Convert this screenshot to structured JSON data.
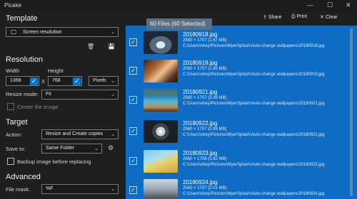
{
  "app": {
    "title": "Picake"
  },
  "toolbar": {
    "share": "Share",
    "print": "Print",
    "clear": "Clear"
  },
  "template": {
    "heading": "Template",
    "selected": "Screen resolution"
  },
  "resolution": {
    "heading": "Resolution",
    "width_label": "Width",
    "height_label": "Height",
    "width": "1366",
    "height": "768",
    "x": "X",
    "unit": "Pixels",
    "resize_mode_label": "Resize mode:",
    "resize_mode": "Fit",
    "center_label": "Center the image"
  },
  "target": {
    "heading": "Target",
    "action_label": "Action:",
    "action": "Resize and Create copies",
    "save_to_label": "Save to:",
    "save_to": "Same Folder",
    "backup_label": "Backup image before replacing"
  },
  "advanced": {
    "heading": "Advanced",
    "file_mask_label": "File mask:",
    "file_mask": "%F"
  },
  "files": {
    "count_label": "60 Files (60 Selected)",
    "items": [
      {
        "name": "20180918.jpg",
        "meta": "2560 × 1707 (1.67 MB)",
        "path": "C:\\Users\\shey\\Pictures\\MyerSplash\\Auto-change wallpapers\\20180918.jpg"
      },
      {
        "name": "20180919.jpg",
        "meta": "2560 × 1707 (1.85 MB)",
        "path": "C:\\Users\\shey\\Pictures\\MyerSplash\\Auto-change wallpapers\\20180919.jpg"
      },
      {
        "name": "20180921.jpg",
        "meta": "2560 × 1707 (3.38 MB)",
        "path": "C:\\Users\\shey\\Pictures\\MyerSplash\\Auto-change wallpapers\\20180921.jpg"
      },
      {
        "name": "20180922.jpg",
        "meta": "2560 × 1707 (0.99 MB)",
        "path": "C:\\Users\\shey\\Pictures\\MyerSplash\\Auto-change wallpapers\\20180922.jpg"
      },
      {
        "name": "20180923.jpg",
        "meta": "2560 × 1708 (0.82 MB)",
        "path": "C:\\Users\\shey\\Pictures\\MyerSplash\\Auto-change wallpapers\\20180923.jpg"
      },
      {
        "name": "20180924.jpg",
        "meta": "2560 × 1707 (2.01 MB)",
        "path": "C:\\Users\\shey\\Pictures\\MyerSplash\\Auto-change wallpapers\\20180924.jpg"
      }
    ]
  }
}
